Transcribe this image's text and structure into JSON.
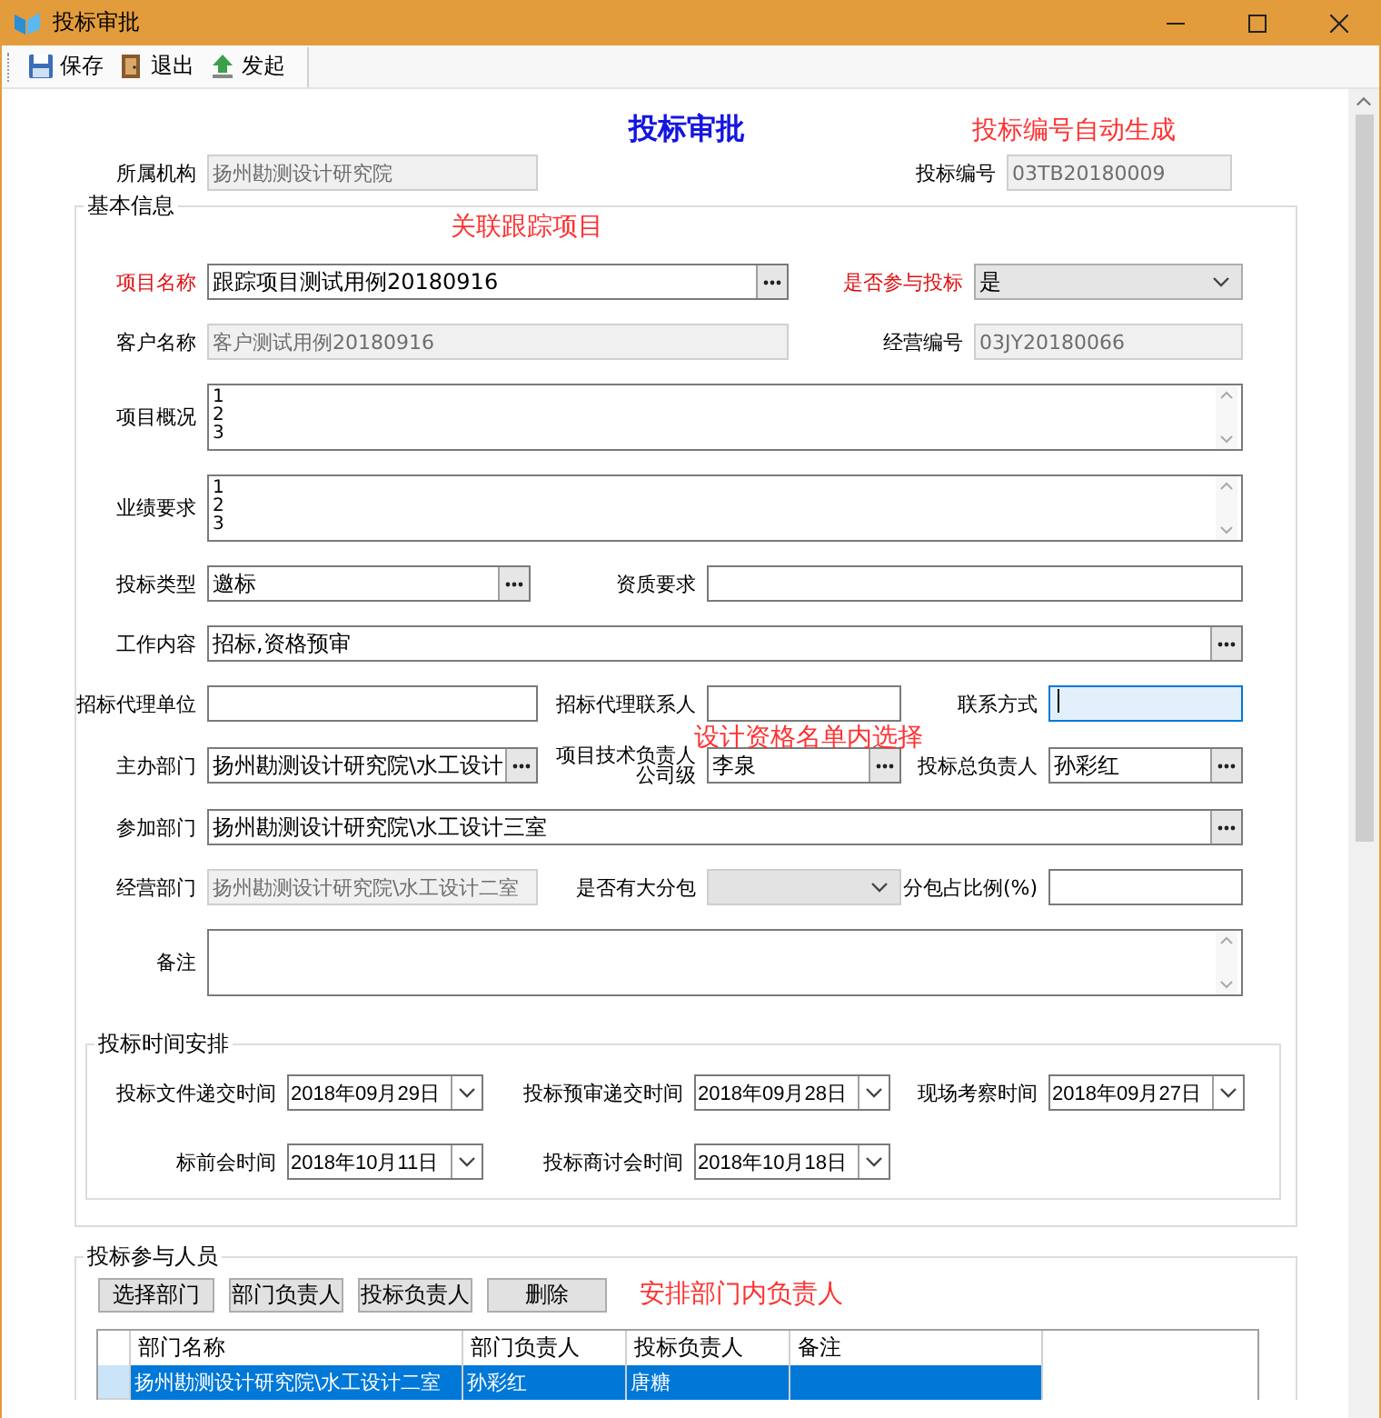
{
  "window": {
    "title": "投标审批"
  },
  "toolbar": [
    {
      "kind": "save",
      "label": "保存"
    },
    {
      "kind": "exit",
      "label": "退出"
    },
    {
      "kind": "launch",
      "label": "发起"
    }
  ],
  "heading": {
    "title": "投标审批",
    "note": "投标编号自动生成"
  },
  "header_row": {
    "kind": "header",
    "fields": [
      {
        "label": "所属机构",
        "kind": "text",
        "value": "扬州勘测设计研究院",
        "required": false,
        "disabled": true
      },
      {
        "label": "投标编号",
        "kind": "text",
        "value": "03TB20180009",
        "required": false,
        "disabled": true
      }
    ]
  },
  "basic_info": {
    "title": "基本信息",
    "note": "关联跟踪项目",
    "rows": [
      {
        "kind": "wide",
        "fields": [
          {
            "label": "项目名称",
            "kind": "lookup",
            "value": "跟踪项目测试用例20180916",
            "required": true,
            "disabled": false
          },
          {
            "label": "是否参与投标",
            "kind": "select",
            "value": "是",
            "required": true,
            "disabled": false
          }
        ]
      },
      {
        "kind": "wide",
        "fields": [
          {
            "label": "客户名称",
            "kind": "text",
            "value": "客户测试用例20180916",
            "required": false,
            "disabled": true
          },
          {
            "label": "经营编号",
            "kind": "text",
            "value": "03JY20180066",
            "required": false,
            "disabled": true
          }
        ]
      },
      {
        "kind": "full",
        "fields": [
          {
            "label": "项目概况",
            "kind": "textarea",
            "value": "1\n2\n3",
            "required": false,
            "disabled": false
          }
        ]
      },
      {
        "kind": "full",
        "fields": [
          {
            "label": "业绩要求",
            "kind": "textarea",
            "value": "1\n2\n3",
            "required": false,
            "disabled": false
          }
        ]
      },
      {
        "kind": "two",
        "fields": [
          {
            "label": "投标类型",
            "kind": "lookup",
            "value": "邀标",
            "required": false,
            "disabled": false
          },
          {
            "label": "资质要求",
            "kind": "text",
            "required": false,
            "disabled": false
          }
        ]
      },
      {
        "kind": "full",
        "fields": [
          {
            "label": "工作内容",
            "kind": "lookup",
            "value": "招标,资格预审",
            "required": false,
            "disabled": false
          }
        ]
      },
      {
        "kind": "three",
        "fields": [
          {
            "label": "招标代理单位",
            "kind": "text",
            "required": false,
            "disabled": false
          },
          {
            "label": "招标代理联系人",
            "kind": "text",
            "required": false,
            "disabled": false
          },
          {
            "label": "联系方式",
            "kind": "text",
            "required": false,
            "disabled": false,
            "focused": true
          }
        ]
      },
      {
        "kind": "three",
        "hint": "设计资格名单内选择",
        "fields": [
          {
            "label": "主办部门",
            "kind": "lookup",
            "value": "扬州勘测设计研究院\\水工设计",
            "required": false,
            "disabled": false
          },
          {
            "label": "项目技术负责人",
            "sublabel": "公司级",
            "kind": "lookup",
            "value": "李泉",
            "required": false,
            "disabled": false
          },
          {
            "label": "投标总负责人",
            "kind": "lookup",
            "value": "孙彩红",
            "required": false,
            "disabled": false
          }
        ]
      },
      {
        "kind": "full",
        "fields": [
          {
            "label": "参加部门",
            "kind": "lookup",
            "value": "扬州勘测设计研究院\\水工设计三室",
            "required": false,
            "disabled": false
          }
        ]
      },
      {
        "kind": "three",
        "fields": [
          {
            "label": "经营部门",
            "kind": "text",
            "value": "扬州勘测设计研究院\\水工设计二室",
            "required": false,
            "disabled": true
          },
          {
            "label": "是否有大分包",
            "kind": "select",
            "required": false,
            "disabled": true
          },
          {
            "label": "分包占比例(%)",
            "kind": "text",
            "required": false,
            "disabled": false
          }
        ]
      },
      {
        "kind": "full",
        "fields": [
          {
            "label": "备注",
            "kind": "textarea",
            "required": false,
            "disabled": false
          }
        ]
      }
    ],
    "schedule": {
      "title": "投标时间安排",
      "rows": [
        {
          "kind": "dates",
          "fields": [
            {
              "label": "投标文件递交时间",
              "kind": "date",
              "value": "2018年09月29日",
              "required": false,
              "disabled": false
            },
            {
              "label": "投标预审递交时间",
              "kind": "date",
              "value": "2018年09月28日",
              "required": false,
              "disabled": false
            },
            {
              "label": "现场考察时间",
              "kind": "date",
              "value": "2018年09月27日",
              "required": false,
              "disabled": false
            }
          ]
        },
        {
          "kind": "dates",
          "fields": [
            {
              "label": "标前会时间",
              "kind": "date",
              "value": "2018年10月11日",
              "required": false,
              "disabled": false
            },
            {
              "label": "投标商讨会时间",
              "kind": "date",
              "value": "2018年10月18日",
              "required": false,
              "disabled": false
            }
          ]
        }
      ]
    }
  },
  "participants": {
    "title": "投标参与人员",
    "note": "安排部门内负责人",
    "buttons": [
      "选择部门",
      "部门负责人",
      "投标负责人",
      "删除"
    ],
    "table": {
      "columns": [
        "部门名称",
        "部门负责人",
        "投标负责人",
        "备注"
      ],
      "rows": [
        {
          "selected": true,
          "cells": [
            "扬州勘测设计研究院\\水工设计二室",
            "孙彩红",
            "唐糖"
          ]
        }
      ]
    }
  }
}
